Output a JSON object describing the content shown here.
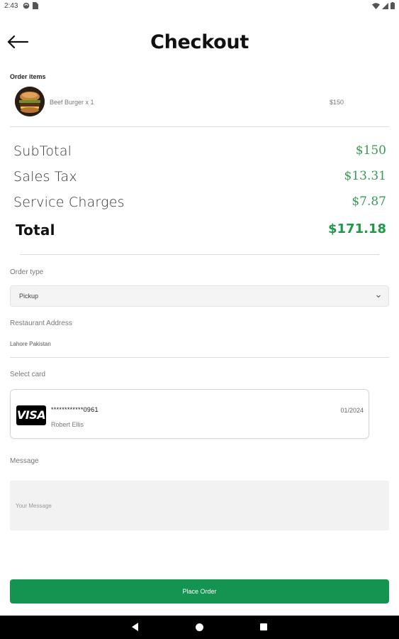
{
  "status_bar": {
    "time": "2:43",
    "left_icons": [
      "sync-icon",
      "sim-card-icon"
    ],
    "right_icons": [
      "wifi-icon",
      "signal-icon",
      "battery-icon"
    ]
  },
  "header": {
    "title": "Checkout",
    "back_icon": "arrow-left-icon"
  },
  "order_items": {
    "label": "Order items",
    "items": [
      {
        "name": "Beef Burger x 1",
        "price": "$150",
        "thumbnail": "burger-image"
      }
    ]
  },
  "summary": {
    "subtotal_label": "SubTotal",
    "subtotal_value": "$150",
    "sales_tax_label": "Sales Tax",
    "sales_tax_value": "$13.31",
    "service_label": "Service Charges",
    "service_value": "$7.87",
    "total_label": "Total",
    "total_value": "$171.18"
  },
  "order_type": {
    "label": "Order type",
    "selected": "Pickup"
  },
  "address": {
    "label": "Restaurant Address",
    "value": "Lahore Pakistan"
  },
  "card": {
    "label": "Select card",
    "brand": "VISA",
    "number": "************0961",
    "holder": "Robert Ellis",
    "expiry": "01/2024"
  },
  "message": {
    "label": "Message",
    "placeholder": "Your Message"
  },
  "place_order_label": "Place Order",
  "colors": {
    "accent": "#139450",
    "price_green": "#3a9a58",
    "total_green": "#1d9a48"
  }
}
